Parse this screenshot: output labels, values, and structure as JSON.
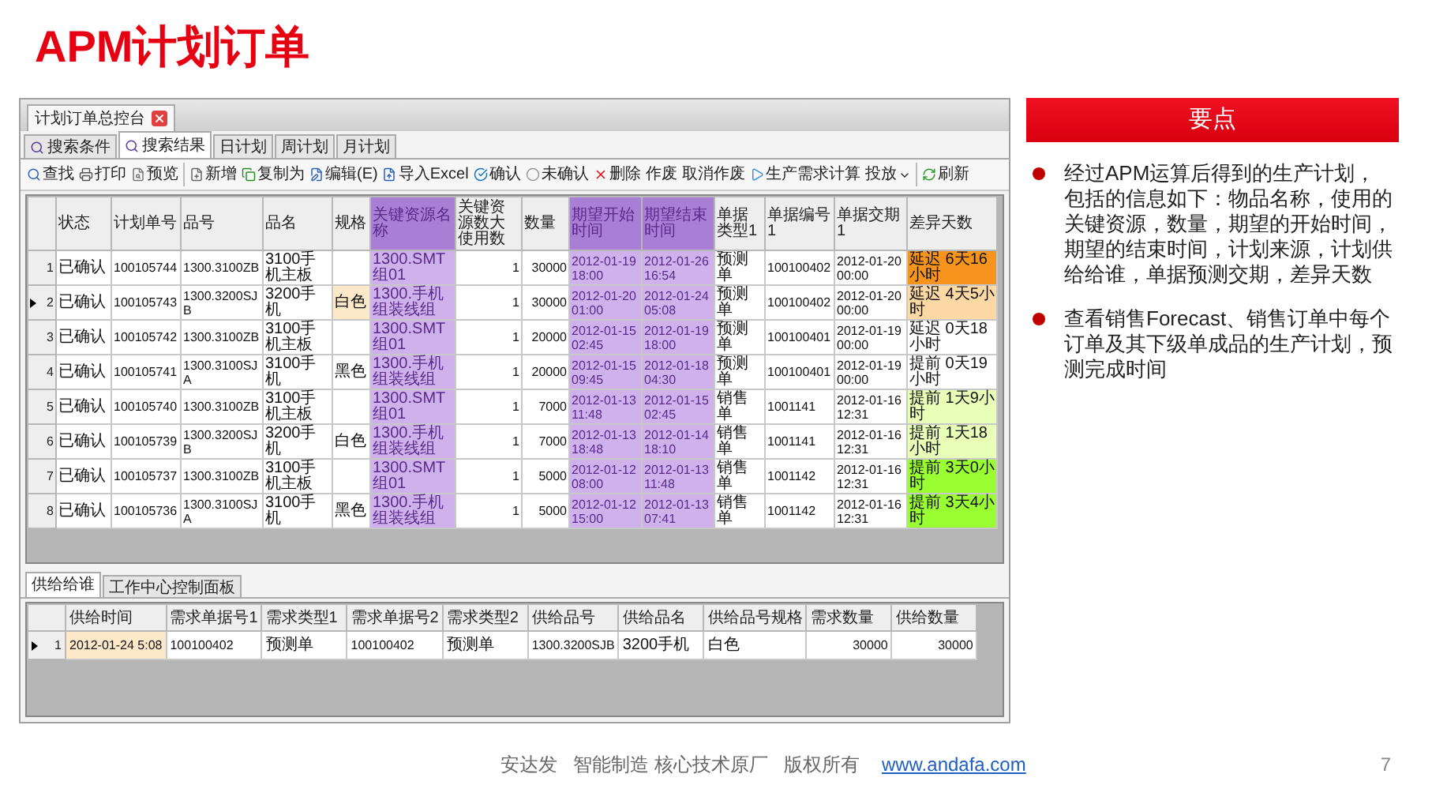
{
  "title": "APM计划订单",
  "app": {
    "window_tab": {
      "label": "计划订单总控台"
    },
    "tabs": [
      {
        "label": "搜索条件",
        "selected": false,
        "kind": "search"
      },
      {
        "label": "搜索结果",
        "selected": true,
        "kind": "search"
      },
      {
        "label": "日计划",
        "selected": false,
        "kind": "plain"
      },
      {
        "label": "周计划",
        "selected": false,
        "kind": "plain"
      },
      {
        "label": "月计划",
        "selected": false,
        "kind": "plain"
      }
    ],
    "toolbar": [
      [
        {
          "label": "查找",
          "kind": "find"
        },
        {
          "label": "打印",
          "kind": "print"
        },
        {
          "label": "预览",
          "kind": "preview"
        }
      ],
      [
        {
          "label": "新增",
          "kind": "new"
        },
        {
          "label": "复制为",
          "kind": "copy"
        },
        {
          "label": "编辑(E)",
          "kind": "edit"
        },
        {
          "label": "导入Excel",
          "kind": "import"
        },
        {
          "label": "确认",
          "kind": "confirm"
        },
        {
          "label": "未确认",
          "kind": "unconfirm"
        },
        {
          "label": "删除",
          "kind": "delete"
        },
        {
          "label": "作废",
          "kind": "text"
        },
        {
          "label": "取消作废",
          "kind": "text"
        },
        {
          "label": "生产需求计算",
          "kind": "run"
        },
        {
          "label": "投放",
          "kind": "dropdown"
        }
      ],
      [
        {
          "label": "刷新",
          "kind": "refresh"
        }
      ]
    ],
    "table": {
      "columns": [
        {
          "label": "状态",
          "highlighted": false
        },
        {
          "label": "计划单号",
          "highlighted": false
        },
        {
          "label": "品号",
          "highlighted": false
        },
        {
          "label": "品名",
          "highlighted": false
        },
        {
          "label": "规格",
          "highlighted": false
        },
        {
          "label": "关键资源名称",
          "highlighted": true
        },
        {
          "label": "关键资源数大使用数",
          "highlighted": false
        },
        {
          "label": "数量",
          "highlighted": false
        },
        {
          "label": "期望开始时间",
          "highlighted": true
        },
        {
          "label": "期望结束时间",
          "highlighted": true
        },
        {
          "label": "单据类型1",
          "highlighted": false
        },
        {
          "label": "单据编号1",
          "highlighted": false
        },
        {
          "label": "单据交期1",
          "highlighted": false
        },
        {
          "label": "差异天数",
          "highlighted": false
        }
      ],
      "rows": [
        {
          "number": "1",
          "selected": false,
          "spec_focused": false,
          "status": "已确认",
          "plan_no": "100105744",
          "item_no": "1300.3100ZB",
          "item_name": "3100手机主板",
          "resource": "1300.SMT组01",
          "usage": "1",
          "qty": "30000",
          "start": "2012-01-19 18:00",
          "end": "2012-01-26 16:54",
          "doc_type": "预测单",
          "doc_no": "100100402",
          "due": "2012-01-20 00:00",
          "diff": "延迟 6天16小时",
          "color": "#f7941d"
        },
        {
          "number": "2",
          "selected": true,
          "spec_focused": true,
          "status": "已确认",
          "plan_no": "100105743",
          "item_no": "1300.3200SJB",
          "item_name": "3200手机",
          "spec": "白色",
          "resource": "1300.手机组装线组",
          "usage": "1",
          "qty": "30000",
          "start": "2012-01-20 01:00",
          "end": "2012-01-24 05:08",
          "doc_type": "预测单",
          "doc_no": "100100402",
          "due": "2012-01-20 00:00",
          "diff": "延迟 4天5小时",
          "color": "#fcd9a4"
        },
        {
          "number": "3",
          "selected": false,
          "spec_focused": false,
          "status": "已确认",
          "plan_no": "100105742",
          "item_no": "1300.3100ZB",
          "item_name": "3100手机主板",
          "resource": "1300.SMT组01",
          "usage": "1",
          "qty": "20000",
          "start": "2012-01-15 02:45",
          "end": "2012-01-19 18:00",
          "doc_type": "预测单",
          "doc_no": "100100401",
          "due": "2012-01-19 00:00",
          "diff": "延迟 0天18小时",
          "color": "#ffffff"
        },
        {
          "number": "4",
          "selected": false,
          "spec_focused": false,
          "status": "已确认",
          "plan_no": "100105741",
          "item_no": "1300.3100SJA",
          "item_name": "3100手机",
          "spec": "黑色",
          "resource": "1300.手机组装线组",
          "usage": "1",
          "qty": "20000",
          "start": "2012-01-15 09:45",
          "end": "2012-01-18 04:30",
          "doc_type": "预测单",
          "doc_no": "100100401",
          "due": "2012-01-19 00:00",
          "diff": "提前 0天19小时",
          "color": "#ffffff"
        },
        {
          "number": "5",
          "selected": false,
          "spec_focused": false,
          "status": "已确认",
          "plan_no": "100105740",
          "item_no": "1300.3100ZB",
          "item_name": "3100手机主板",
          "resource": "1300.SMT组01",
          "usage": "1",
          "qty": "7000",
          "start": "2012-01-13 11:48",
          "end": "2012-01-15 02:45",
          "doc_type": "销售单",
          "doc_no": "1001141",
          "due": "2012-01-16 12:31",
          "diff": "提前 1天9小时",
          "color": "#e8ffb8"
        },
        {
          "number": "6",
          "selected": false,
          "spec_focused": false,
          "status": "已确认",
          "plan_no": "100105739",
          "item_no": "1300.3200SJB",
          "item_name": "3200手机",
          "spec": "白色",
          "resource": "1300.手机组装线组",
          "usage": "1",
          "qty": "7000",
          "start": "2012-01-13 18:48",
          "end": "2012-01-14 18:10",
          "doc_type": "销售单",
          "doc_no": "1001141",
          "due": "2012-01-16 12:31",
          "diff": "提前 1天18小时",
          "color": "#e8ffb8"
        },
        {
          "number": "7",
          "selected": false,
          "spec_focused": false,
          "status": "已确认",
          "plan_no": "100105737",
          "item_no": "1300.3100ZB",
          "item_name": "3100手机主板",
          "resource": "1300.SMT组01",
          "usage": "1",
          "qty": "5000",
          "start": "2012-01-12 08:00",
          "end": "2012-01-13 11:48",
          "doc_type": "销售单",
          "doc_no": "1001142",
          "due": "2012-01-16 12:31",
          "diff": "提前 3天0小时",
          "color": "#99ff33"
        },
        {
          "number": "8",
          "selected": false,
          "spec_focused": false,
          "status": "已确认",
          "plan_no": "100105736",
          "item_no": "1300.3100SJA",
          "item_name": "3100手机",
          "spec": "黑色",
          "resource": "1300.手机组装线组",
          "usage": "1",
          "qty": "5000",
          "start": "2012-01-12 15:00",
          "end": "2012-01-13 07:41",
          "doc_type": "销售单",
          "doc_no": "1001142",
          "due": "2012-01-16 12:31",
          "diff": "提前 3天4小时",
          "color": "#99ff33"
        }
      ]
    },
    "bottom_tabs": [
      {
        "label": "供给给谁",
        "selected": true
      },
      {
        "label": "工作中心控制面板",
        "selected": false
      }
    ],
    "bottom_table": {
      "columns": [
        {
          "label": "供给时间",
          "kind": "text"
        },
        {
          "label": "需求单据号1",
          "kind": "text"
        },
        {
          "label": "需求类型1",
          "kind": "text"
        },
        {
          "label": "需求单据号2",
          "kind": "text"
        },
        {
          "label": "需求类型2",
          "kind": "text"
        },
        {
          "label": "供给品号",
          "kind": "text"
        },
        {
          "label": "供给品名",
          "kind": "text"
        },
        {
          "label": "供给品号规格",
          "kind": "text"
        },
        {
          "label": "需求数量",
          "kind": "number"
        },
        {
          "label": "供给数量",
          "kind": "number"
        }
      ],
      "rows": [
        {
          "number": "1",
          "selected": true,
          "cells": [
            {
              "text": "2012-01-24 5:08",
              "focused": true
            },
            {
              "text": "100100402",
              "focused": false
            },
            {
              "text": "预测单",
              "focused": false
            },
            {
              "text": "100100402",
              "focused": false
            },
            {
              "text": "预测单",
              "focused": false
            },
            {
              "text": "1300.3200SJB",
              "focused": false
            },
            {
              "text": "3200手机",
              "focused": false
            },
            {
              "text": "白色",
              "focused": false
            },
            {
              "text": "30000",
              "focused": false
            },
            {
              "text": "30000",
              "focused": false
            }
          ]
        }
      ]
    }
  },
  "key_points": {
    "heading": "要点",
    "bullets": [
      "经过APM运算后得到的生产计划，包括的信息如下：物品名称，使用的关键资源，数量，期望的开始时间，期望的结束时间，计划来源，计划供给给谁，单据预测交期，差异天数",
      "查看销售Forecast、销售订单中每个订单及其下级单成品的生产计划，预测完成时间"
    ]
  },
  "footer": {
    "text": "安达发   智能制造 核心技术原厂   版权所有",
    "link": "www.andafa.com",
    "page": "7"
  }
}
